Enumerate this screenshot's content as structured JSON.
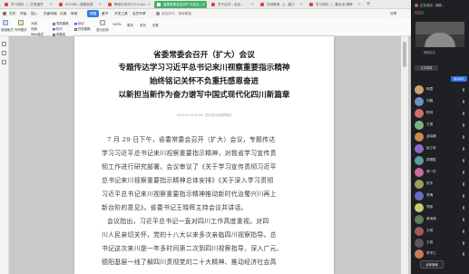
{
  "tabs": [
    {
      "label": "学习资料（...共青团员",
      "color": "#e0443b"
    },
    {
      "label": "2023年...视频到底",
      "color": "#e0443b"
    },
    {
      "label": "教研计划书1721.doc",
      "color": "#e0443b"
    },
    {
      "label": "省委常委会召开扩大会议...",
      "color": "#ffffff"
    },
    {
      "label": "关于召开…会议...",
      "color": "#e0443b"
    },
    {
      "label": "在线教育..上...能力",
      "color": "#e0443b"
    },
    {
      "label": "学习资料（...要讲话 精神",
      "color": "#e0443b"
    }
  ],
  "menu": {
    "items": [
      "文件",
      "开始",
      "插入",
      "页面布局",
      "引用",
      "审阅",
      "视图",
      "章节",
      "开发工具",
      "会员专享"
    ],
    "active": "视图",
    "search": "查找命令、搜索模板",
    "share": "分享"
  },
  "ribbon": {
    "views": [
      "阅读版式",
      "写作模式"
    ],
    "view_mode_labels": [
      "大纲",
      "页面",
      "Web版式"
    ],
    "checks": [
      {
        "label": "导航窗格",
        "on": false
      },
      {
        "label": "标尺",
        "on": true
      },
      {
        "label": "网格线",
        "on": false
      },
      {
        "label": "标记",
        "on": true
      },
      {
        "label": "任务窗格",
        "on": false
      }
    ],
    "zoom_labels": [
      "显示比例",
      "100%",
      "单页",
      "多页",
      "页宽"
    ]
  },
  "document": {
    "headings": [
      "省委常委会召开（扩大）会议",
      "专题传达学习习近平总书记来川视察重要指示精神",
      "始终铭记关怀不负重托感恩奋进",
      "以新担当新作为奋力谱写中国式现代化四川新篇章"
    ],
    "byline": "2023-07-30 20:39 · 四川省人民政府网站",
    "lines": [
      "7 月 29 日下午，省委常委会召开（扩大）会议，专题传达",
      "学习习近平总书记来川视察重要指示精神，对我省学习宣传贯",
      "彻工作进行研究部署。会议审议了《关于学习宣传贯彻习近平",
      "总书记来川视察重要指示精神总体安排》《关于深入学习贯彻",
      "习近平总书记来川视察重要指示精神推动新时代治蜀兴川再上",
      "新台阶的意见》。省委书记王晓晖主持会议并讲话。",
      "会议指出，习近平总书记一直对四川工作高度重视。对四",
      "川人民亲切关怀，党的十八大以来多次亲临四川视察指导。总",
      "书记这次来川是一年多时间第二次到四川视察指导，深入广元、",
      "德阳基层一线了解四川贯彻党的二十大精神、推动经济社会高"
    ]
  },
  "panel": {
    "title": "正在讲话：视频...",
    "video_label": "视频会议",
    "share_label": "共享屏幕",
    "invite_label": "邀请成员",
    "participants": [
      {
        "name": "杨霞",
        "color": "#c9a36a"
      },
      {
        "name": "刘峰",
        "color": "#6a8fc9"
      },
      {
        "name": "陈林",
        "color": "#d16d6d"
      },
      {
        "name": "王丽",
        "color": "#7bb37b"
      },
      {
        "name": "孟晓娜",
        "color": "#c98a4a"
      },
      {
        "name": "赵立军",
        "color": "#8a6ac9"
      },
      {
        "name": "邵德胜",
        "color": "#5a9e9e"
      },
      {
        "name": "周一珍",
        "color": "#c96a9e"
      },
      {
        "name": "张华",
        "color": "#9e9e5a"
      },
      {
        "name": "李梅",
        "color": "#6a6ac9"
      },
      {
        "name": "郑丽",
        "color": "#c9c96a"
      },
      {
        "name": "黄海燕",
        "color": "#5a7f5a"
      },
      {
        "name": "王明",
        "color": "#a05a5a"
      },
      {
        "name": "王艳",
        "color": "#5a5a5a"
      },
      {
        "name": "李学江",
        "color": "#c97a5a"
      }
    ],
    "mute_all": "全体静音"
  }
}
